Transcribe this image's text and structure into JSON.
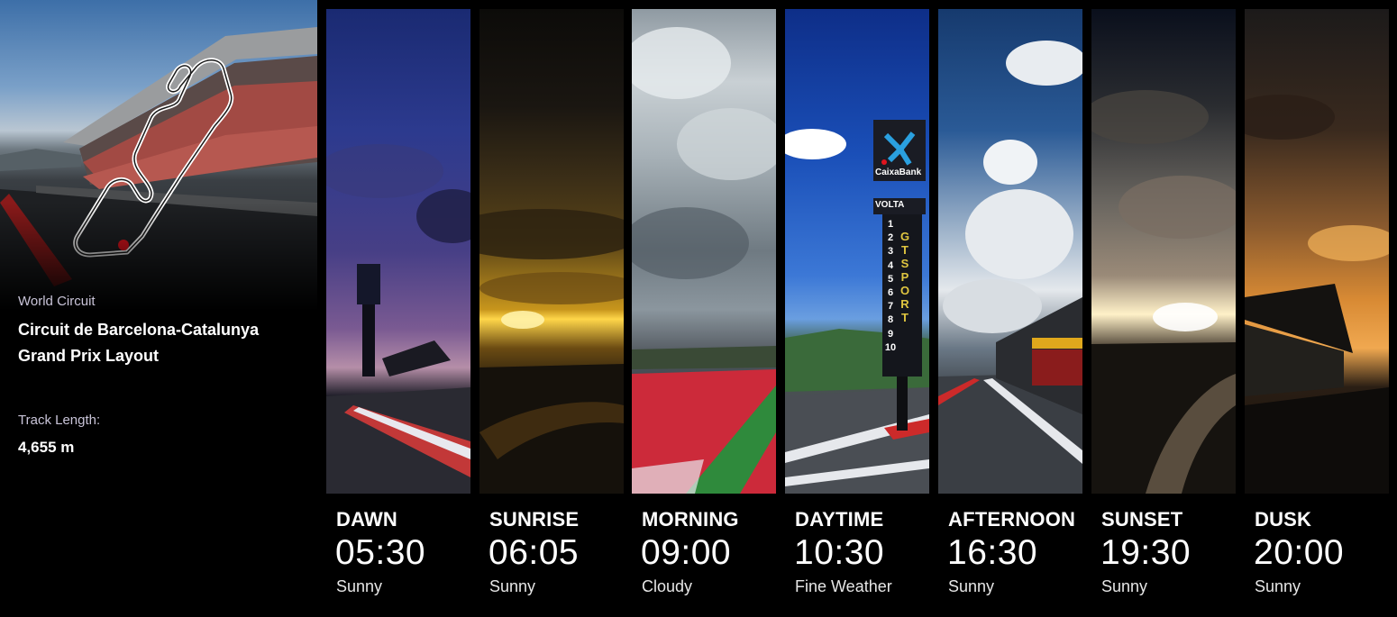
{
  "track": {
    "category": "World Circuit",
    "name_line1": "Circuit de Barcelona-Catalunya",
    "name_line2": "Grand Prix Layout",
    "length_label": "Track Length:",
    "length_value": "4,655 m"
  },
  "times": [
    {
      "label": "DAWN",
      "time": "05:30",
      "weather": "Sunny"
    },
    {
      "label": "SUNRISE",
      "time": "06:05",
      "weather": "Sunny"
    },
    {
      "label": "MORNING",
      "time": "09:00",
      "weather": "Cloudy"
    },
    {
      "label": "DAYTIME",
      "time": "10:30",
      "weather": "Fine Weather"
    },
    {
      "label": "AFTERNOON",
      "time": "16:30",
      "weather": "Sunny"
    },
    {
      "label": "SUNSET",
      "time": "19:30",
      "weather": "Sunny"
    },
    {
      "label": "DUSK",
      "time": "20:00",
      "weather": "Sunny"
    }
  ],
  "scene_text": {
    "sponsor": "CaixaBank",
    "tower_header": "VOLTA",
    "tower_numbers": [
      "1",
      "2",
      "3",
      "4",
      "5",
      "6",
      "7",
      "8",
      "9",
      "10"
    ],
    "tower_side": "GT SPORT"
  },
  "colors": {
    "background": "#000000",
    "label_muted": "#c9c4d8",
    "track_marker": "#e0141e"
  }
}
